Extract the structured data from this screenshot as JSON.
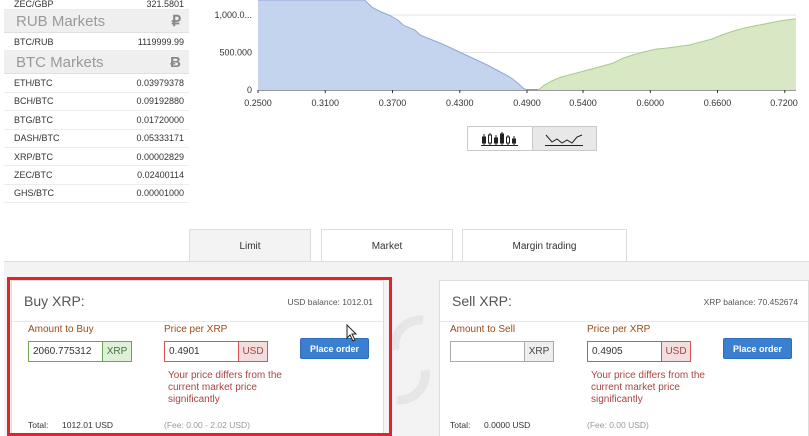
{
  "markets": {
    "top_pair": {
      "pair": "ZEC/GBP",
      "price": "321.5801"
    },
    "rub_header": {
      "label": "RUB Markets",
      "symbol": "₽"
    },
    "rub_rows": [
      {
        "pair": "BTC/RUB",
        "price": "1119999.99"
      }
    ],
    "btc_header": {
      "label": "BTC Markets",
      "symbol": "Ƀ"
    },
    "btc_rows": [
      {
        "pair": "ETH/BTC",
        "price": "0.03979378"
      },
      {
        "pair": "BCH/BTC",
        "price": "0.09192880"
      },
      {
        "pair": "BTG/BTC",
        "price": "0.01720000"
      },
      {
        "pair": "DASH/BTC",
        "price": "0.05333171"
      },
      {
        "pair": "XRP/BTC",
        "price": "0.00002829"
      },
      {
        "pair": "ZEC/BTC",
        "price": "0.02400114"
      },
      {
        "pair": "GHS/BTC",
        "price": "0.00001000"
      }
    ]
  },
  "chart_data": {
    "type": "area",
    "x_ticks": [
      "0.2500",
      "0.3100",
      "0.3700",
      "0.4300",
      "0.4900",
      "0.5400",
      "0.6000",
      "0.6600",
      "0.7200"
    ],
    "y_ticks": [
      "0",
      "500.000",
      "1,000.0..."
    ],
    "ylim": [
      0,
      1200
    ],
    "xlim": [
      0.25,
      0.73
    ],
    "series": [
      {
        "color": "#c5d4ee",
        "points": [
          [
            0.25,
            1200
          ],
          [
            0.345,
            1200
          ],
          [
            0.352,
            1100
          ],
          [
            0.36,
            1040
          ],
          [
            0.368,
            990
          ],
          [
            0.375,
            930
          ],
          [
            0.38,
            860
          ],
          [
            0.39,
            800
          ],
          [
            0.395,
            730
          ],
          [
            0.405,
            670
          ],
          [
            0.415,
            610
          ],
          [
            0.425,
            540
          ],
          [
            0.435,
            470
          ],
          [
            0.445,
            400
          ],
          [
            0.455,
            330
          ],
          [
            0.465,
            250
          ],
          [
            0.475,
            170
          ],
          [
            0.482,
            90
          ],
          [
            0.487,
            20
          ],
          [
            0.49,
            0
          ]
        ]
      },
      {
        "color": "#d9e8c4",
        "points": [
          [
            0.5,
            0
          ],
          [
            0.505,
            60
          ],
          [
            0.512,
            120
          ],
          [
            0.52,
            170
          ],
          [
            0.53,
            210
          ],
          [
            0.54,
            250
          ],
          [
            0.55,
            290
          ],
          [
            0.56,
            330
          ],
          [
            0.567,
            360
          ],
          [
            0.575,
            420
          ],
          [
            0.585,
            470
          ],
          [
            0.595,
            510
          ],
          [
            0.605,
            545
          ],
          [
            0.615,
            560
          ],
          [
            0.625,
            580
          ],
          [
            0.635,
            600
          ],
          [
            0.645,
            640
          ],
          [
            0.655,
            680
          ],
          [
            0.665,
            740
          ],
          [
            0.675,
            790
          ],
          [
            0.685,
            830
          ],
          [
            0.695,
            860
          ],
          [
            0.705,
            890
          ],
          [
            0.715,
            920
          ],
          [
            0.725,
            940
          ],
          [
            0.73,
            950
          ]
        ]
      }
    ]
  },
  "tabs": [
    {
      "label": "Limit"
    },
    {
      "label": "Market"
    },
    {
      "label": "Margin trading"
    }
  ],
  "buy": {
    "title": "Buy XRP:",
    "balance": "USD balance: 1012.01",
    "amount_label": "Amount to Buy",
    "amount_value": "2060.775312",
    "amount_unit": "XRP",
    "price_label": "Price per XRP",
    "price_value": "0.4901",
    "price_unit": "USD",
    "button": "Place order",
    "warning": "Your price differs from the current market price significantly",
    "total_label": "Total:",
    "total_value": "1012.01 USD",
    "fee": "(Fee: 0.00 - 2.02 USD)"
  },
  "sell": {
    "title": "Sell XRP:",
    "balance": "XRP balance: 70.452674",
    "amount_label": "Amount to Sell",
    "amount_value": "",
    "amount_unit": "XRP",
    "price_label": "Price per XRP",
    "price_value": "0.4905",
    "price_unit": "USD",
    "button": "Place order",
    "warning": "Your price differs from the current market price significantly",
    "total_label": "Total:",
    "total_value": "0.0000 USD",
    "fee": "(Fee: 0.00 USD)"
  }
}
